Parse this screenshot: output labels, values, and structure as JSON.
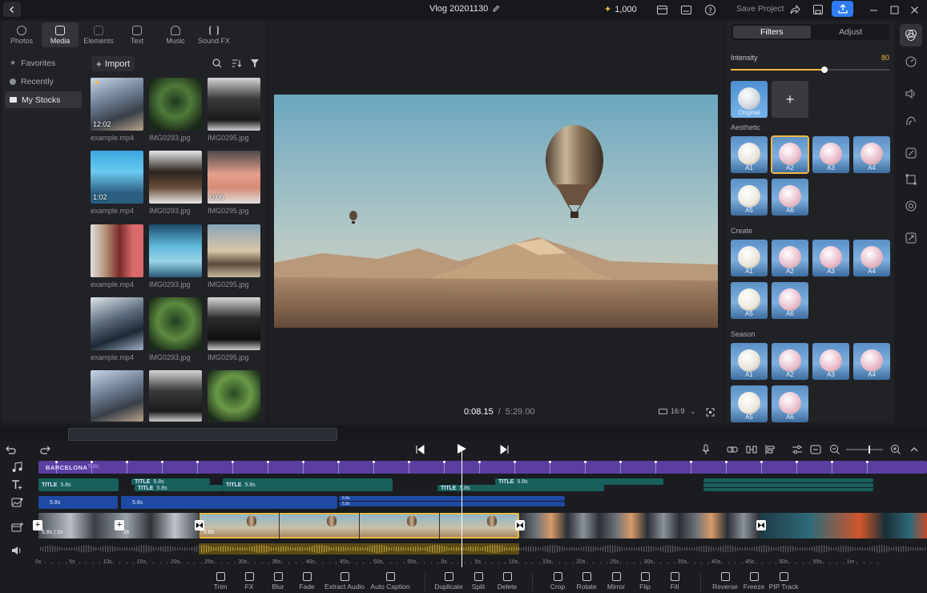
{
  "topbar": {
    "project_title": "Vlog 20201130",
    "credits": "1,000",
    "save_project": "Save Project"
  },
  "media": {
    "tabs": [
      {
        "label": "Photos"
      },
      {
        "label": "Media"
      },
      {
        "label": "Elements"
      },
      {
        "label": "Text"
      },
      {
        "label": "Music"
      },
      {
        "label": "Sound FX"
      }
    ],
    "nav": [
      {
        "label": "Favorites"
      },
      {
        "label": "Recently"
      },
      {
        "label": "My Stocks"
      }
    ],
    "import_label": "Import",
    "items": [
      {
        "name": "example.mp4",
        "duration": "12:02"
      },
      {
        "name": "IMG0293.jpg",
        "duration": ""
      },
      {
        "name": "IMG0295.jpg",
        "duration": ""
      },
      {
        "name": "example.mp4",
        "duration": "1:02"
      },
      {
        "name": "IMG0293.jpg",
        "duration": ""
      },
      {
        "name": "IMG0295.jpg",
        "duration": "0:06"
      },
      {
        "name": "example.mp4",
        "duration": ""
      },
      {
        "name": "IMG0293.jpg",
        "duration": ""
      },
      {
        "name": "IMG0295.jpg",
        "duration": ""
      },
      {
        "name": "example.mp4",
        "duration": ""
      },
      {
        "name": "IMG0293.jpg",
        "duration": ""
      },
      {
        "name": "IMG0295.jpg",
        "duration": ""
      },
      {
        "name": "",
        "duration": ""
      },
      {
        "name": "",
        "duration": ""
      },
      {
        "name": "",
        "duration": ""
      }
    ]
  },
  "preview": {
    "current_time": "0:08.15",
    "separator": "/",
    "total_time": "5:29.00",
    "aspect_ratio": "16:9"
  },
  "filters": {
    "tabs": [
      "Filters",
      "Adjust"
    ],
    "intensity_label": "Intensity",
    "intensity_value": 80,
    "original_label": "Original",
    "sections": [
      {
        "title": "Aesthetic",
        "items": [
          "A1",
          "A2",
          "A3",
          "A4",
          "A5",
          "A6"
        ]
      },
      {
        "title": "Create",
        "items": [
          "A1",
          "A2",
          "A3",
          "A4",
          "A5",
          "A6"
        ]
      },
      {
        "title": "Season",
        "items": [
          "A1",
          "A2",
          "A3",
          "A4",
          "A5",
          "A6"
        ]
      }
    ],
    "selected": "A2"
  },
  "timeline": {
    "music_clip": {
      "label": "BARCELONA",
      "duration": "5.8s"
    },
    "title_clips": [
      {
        "label": "TITLE",
        "duration": "5.8s"
      },
      {
        "label": "TITLE",
        "duration": "5.8s"
      },
      {
        "label": "TITLE",
        "duration": "5.8s"
      },
      {
        "label": "TITLE",
        "duration": "5.8s"
      },
      {
        "label": "TITLE",
        "duration": "5.8s"
      },
      {
        "label": "TITLE",
        "duration": "5.8s"
      }
    ],
    "overlay_clips": [
      {
        "duration": "5.8s"
      },
      {
        "duration": "5.8s"
      },
      {
        "duration": "5.8s"
      },
      {
        "duration": "5.8s"
      }
    ],
    "video_clips": [
      {
        "label": "5.8s | 2x"
      },
      {
        "label": "2x"
      },
      {
        "label": "5.8s"
      }
    ],
    "ruler": [
      "0s",
      "5s",
      "10s",
      "15s",
      "20s",
      "25s",
      "30s",
      "35s",
      "40s",
      "45s",
      "50s",
      "55s",
      "0s",
      "5s",
      "10s",
      "15s",
      "20s",
      "25s",
      "30s",
      "35s",
      "40s",
      "45s",
      "50s",
      "55s",
      "1m"
    ],
    "tools": [
      {
        "label": "Trim"
      },
      {
        "label": "FX"
      },
      {
        "label": "Blur"
      },
      {
        "label": "Fade"
      },
      {
        "label": "Extract Audio"
      },
      {
        "label": "Auto Caption"
      },
      {
        "label": "Duplicate"
      },
      {
        "label": "Split"
      },
      {
        "label": "Delete"
      },
      {
        "label": "Crop"
      },
      {
        "label": "Rotate"
      },
      {
        "label": "Mirror"
      },
      {
        "label": "Flip"
      },
      {
        "label": "Fill"
      },
      {
        "label": "Reverse"
      },
      {
        "label": "Freeze"
      },
      {
        "label": "PIP Track"
      }
    ]
  },
  "colors": {
    "accent": "#2f7cf6",
    "highlight": "#f1b843",
    "music_track": "#5b3fa0",
    "title_track": "#17605c",
    "overlay_track": "#1f4aa3"
  }
}
